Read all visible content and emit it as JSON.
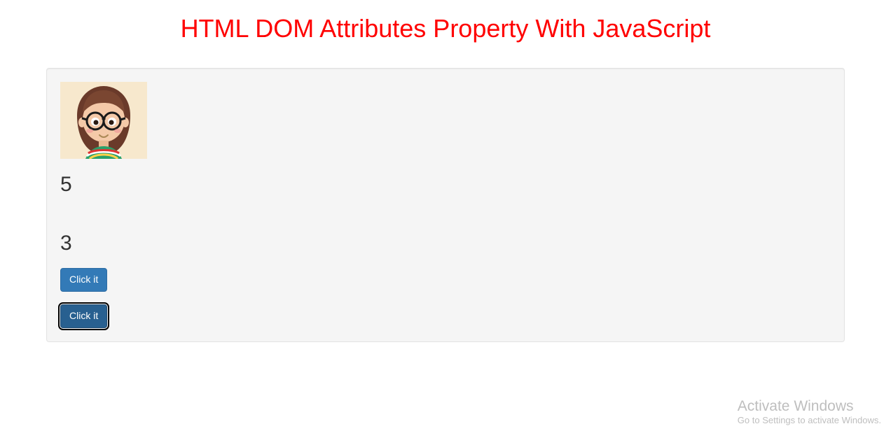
{
  "header": {
    "title": "HTML DOM Attributes Property With JavaScript"
  },
  "avatar": {
    "name": "cartoon-girl-avatar"
  },
  "results": {
    "first": "5",
    "second": "3"
  },
  "buttons": {
    "click1_label": "Click it",
    "click2_label": "Click it"
  },
  "watermark": {
    "title": "Activate Windows",
    "subtitle": "Go to Settings to activate Windows."
  }
}
